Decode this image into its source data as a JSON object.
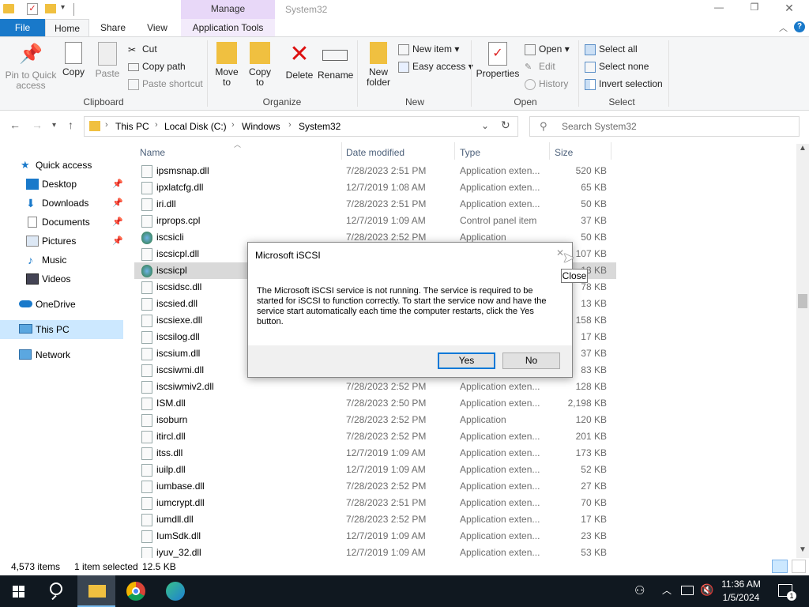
{
  "title_bar": {
    "manage_tab": "Manage",
    "window_title": "System32",
    "minimize": "—",
    "maximize": "❐",
    "close": "✕"
  },
  "ribbon_tabs": {
    "file": "File",
    "home": "Home",
    "share": "Share",
    "view": "View",
    "app_tools": "Application Tools"
  },
  "ribbon": {
    "clipboard": {
      "label": "Clipboard",
      "pin": "Pin to Quick access",
      "copy": "Copy",
      "paste": "Paste",
      "cut": "Cut",
      "copy_path": "Copy path",
      "paste_shortcut": "Paste shortcut"
    },
    "organize": {
      "label": "Organize",
      "move_to": "Move to",
      "copy_to": "Copy to",
      "delete": "Delete",
      "rename": "Rename"
    },
    "new": {
      "label": "New",
      "new_folder": "New folder",
      "new_item": "New item",
      "easy_access": "Easy access"
    },
    "open": {
      "label": "Open",
      "properties": "Properties",
      "open": "Open",
      "edit": "Edit",
      "history": "History"
    },
    "select": {
      "label": "Select",
      "select_all": "Select all",
      "select_none": "Select none",
      "invert": "Invert selection"
    }
  },
  "address": {
    "crumbs": [
      "This PC",
      "Local Disk (C:)",
      "Windows",
      "System32"
    ],
    "search_placeholder": "Search System32"
  },
  "nav": {
    "quick_access": "Quick access",
    "desktop": "Desktop",
    "downloads": "Downloads",
    "documents": "Documents",
    "pictures": "Pictures",
    "music": "Music",
    "videos": "Videos",
    "onedrive": "OneDrive",
    "this_pc": "This PC",
    "network": "Network"
  },
  "columns": {
    "name": "Name",
    "date": "Date modified",
    "type": "Type",
    "size": "Size"
  },
  "files": [
    {
      "name": "ipsmsnap.dll",
      "date": "7/28/2023 2:51 PM",
      "type": "Application exten...",
      "size": "520 KB"
    },
    {
      "name": "ipxlatcfg.dll",
      "date": "12/7/2019 1:08 AM",
      "type": "Application exten...",
      "size": "65 KB"
    },
    {
      "name": "iri.dll",
      "date": "7/28/2023 2:51 PM",
      "type": "Application exten...",
      "size": "50 KB"
    },
    {
      "name": "irprops.cpl",
      "date": "12/7/2019 1:09 AM",
      "type": "Control panel item",
      "size": "37 KB"
    },
    {
      "name": "iscsicli",
      "date": "7/28/2023 2:52 PM",
      "type": "Application",
      "size": "50 KB"
    },
    {
      "name": "iscsicpl.dll",
      "date": "",
      "type": "",
      "size": "107 KB"
    },
    {
      "name": "iscsicpl",
      "date": "",
      "type": "",
      "size": "13 KB"
    },
    {
      "name": "iscsidsc.dll",
      "date": "",
      "type": "",
      "size": "78 KB"
    },
    {
      "name": "iscsied.dll",
      "date": "",
      "type": "",
      "size": "13 KB"
    },
    {
      "name": "iscsiexe.dll",
      "date": "",
      "type": "",
      "size": "158 KB"
    },
    {
      "name": "iscsilog.dll",
      "date": "",
      "type": "",
      "size": "17 KB"
    },
    {
      "name": "iscsium.dll",
      "date": "",
      "type": "",
      "size": "37 KB"
    },
    {
      "name": "iscsiwmi.dll",
      "date": "",
      "type": "",
      "size": "83 KB"
    },
    {
      "name": "iscsiwmiv2.dll",
      "date": "7/28/2023 2:52 PM",
      "type": "Application exten...",
      "size": "128 KB"
    },
    {
      "name": "ISM.dll",
      "date": "7/28/2023 2:50 PM",
      "type": "Application exten...",
      "size": "2,198 KB"
    },
    {
      "name": "isoburn",
      "date": "7/28/2023 2:52 PM",
      "type": "Application",
      "size": "120 KB"
    },
    {
      "name": "itircl.dll",
      "date": "7/28/2023 2:52 PM",
      "type": "Application exten...",
      "size": "201 KB"
    },
    {
      "name": "itss.dll",
      "date": "12/7/2019 1:09 AM",
      "type": "Application exten...",
      "size": "173 KB"
    },
    {
      "name": "iuilp.dll",
      "date": "12/7/2019 1:09 AM",
      "type": "Application exten...",
      "size": "52 KB"
    },
    {
      "name": "iumbase.dll",
      "date": "7/28/2023 2:52 PM",
      "type": "Application exten...",
      "size": "27 KB"
    },
    {
      "name": "iumcrypt.dll",
      "date": "7/28/2023 2:51 PM",
      "type": "Application exten...",
      "size": "70 KB"
    },
    {
      "name": "iumdll.dll",
      "date": "7/28/2023 2:52 PM",
      "type": "Application exten...",
      "size": "17 KB"
    },
    {
      "name": "IumSdk.dll",
      "date": "12/7/2019 1:09 AM",
      "type": "Application exten...",
      "size": "23 KB"
    },
    {
      "name": "iyuv_32.dll",
      "date": "12/7/2019 1:09 AM",
      "type": "Application exten...",
      "size": "53 KB"
    }
  ],
  "status": {
    "count": "4,573 items",
    "selected": "1 item selected",
    "size": "12.5 KB"
  },
  "dialog": {
    "title": "Microsoft iSCSI",
    "message": "The Microsoft iSCSI service is not running. The service is required to be started for iSCSI to function correctly. To start the service now and have the service start automatically each time the computer restarts, click the Yes button.",
    "yes": "Yes",
    "no": "No",
    "tooltip": "Close"
  },
  "taskbar": {
    "time": "11:36 AM",
    "date": "1/5/2024",
    "notif_count": "1"
  },
  "colors": {
    "accent": "#0078d7",
    "file_tab": "#1979ca",
    "taskbar": "#101820",
    "selection": "#cce8ff",
    "manage_tab": "#e8d8f8"
  }
}
